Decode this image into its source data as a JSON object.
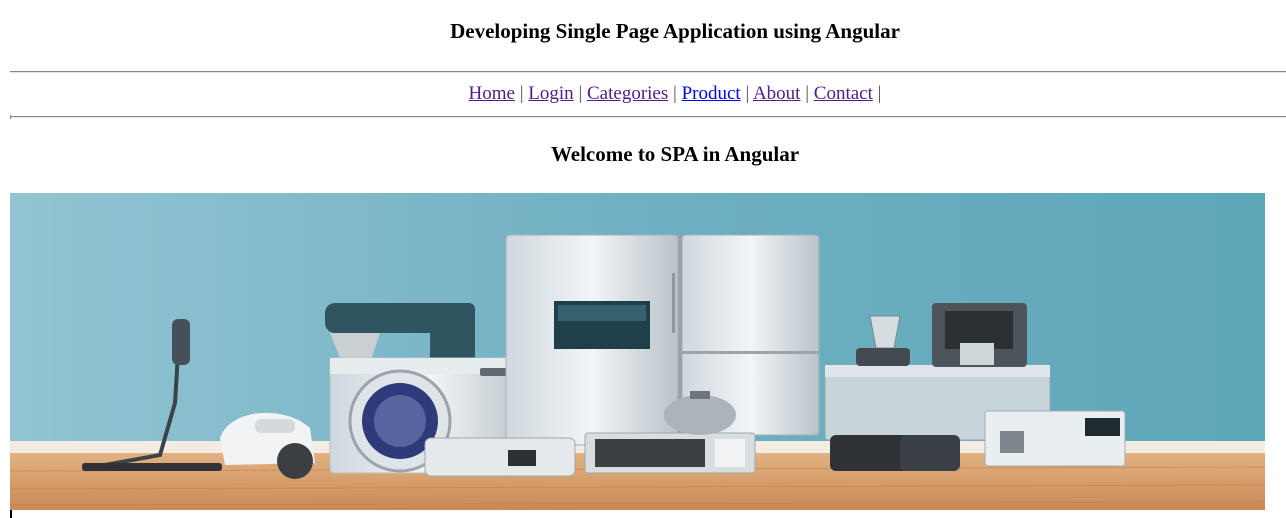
{
  "header": {
    "title": "Developing Single Page Application using Angular"
  },
  "nav": {
    "items": [
      {
        "label": "Home"
      },
      {
        "label": "Login"
      },
      {
        "label": "Categories"
      },
      {
        "label": "Product"
      },
      {
        "label": "About"
      },
      {
        "label": "Contact"
      }
    ],
    "separator": "|"
  },
  "main": {
    "heading": "Welcome to SPA in Angular",
    "hero_image": {
      "alt": "home appliances: vacuum cleaner, stand mixer, washing machine, refrigerator, microwave, coffee makers and kitchen gadgets on a wooden floor against a teal wall"
    }
  },
  "colors": {
    "link_visited": "#551a8b",
    "link_unvisited": "#0000ee",
    "wall": "#6fb0c2",
    "floor": "#d9a06a"
  }
}
